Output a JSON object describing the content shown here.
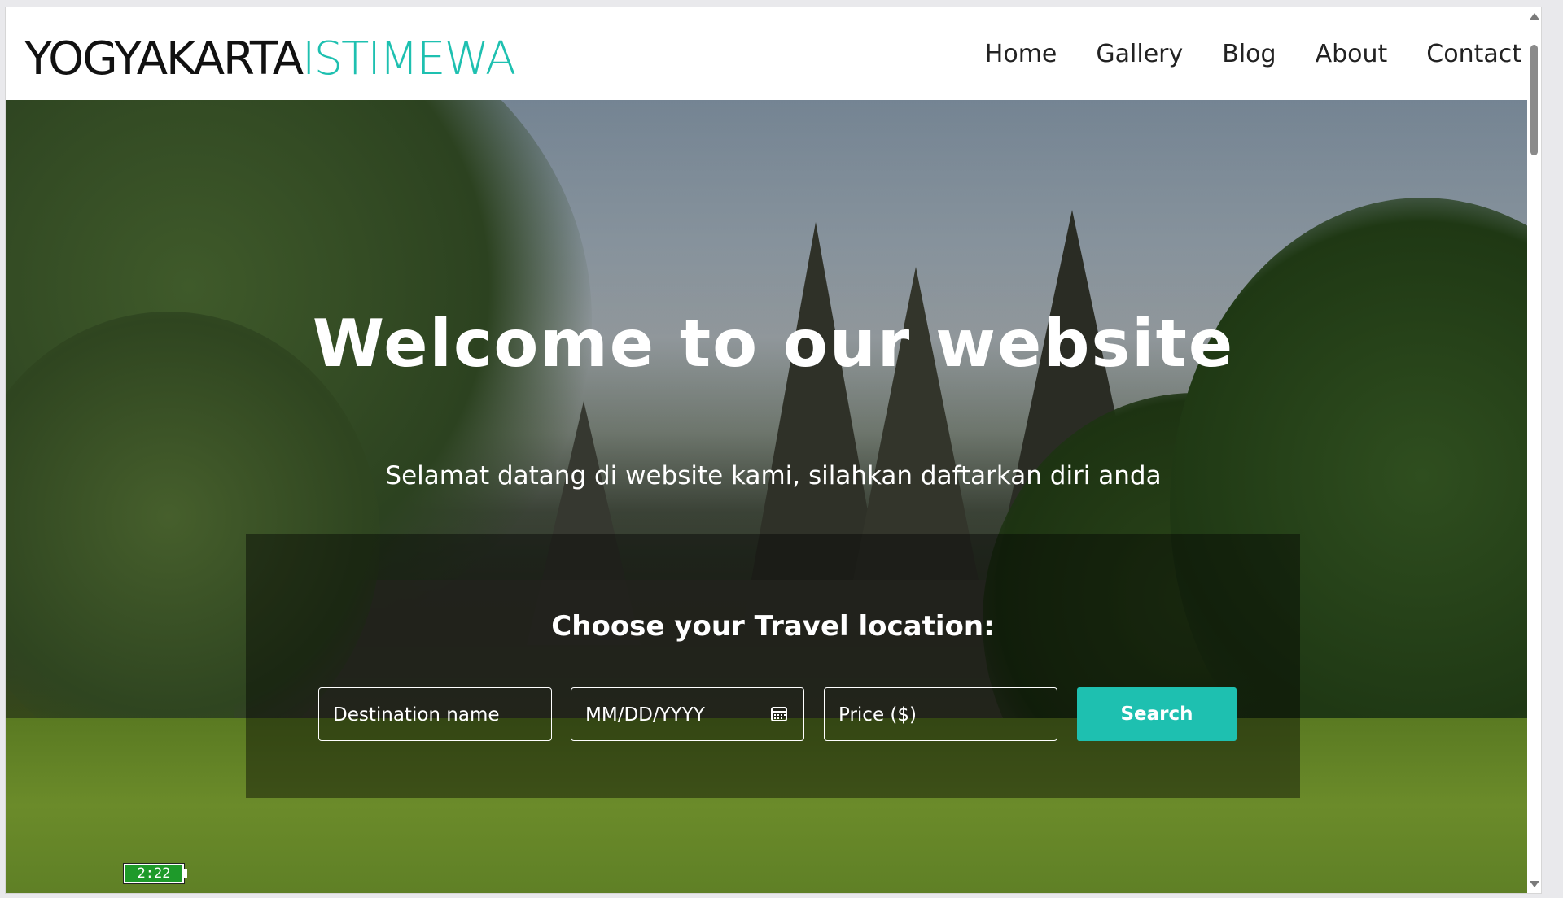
{
  "site": {
    "logo_main": "YOGYAKARTA",
    "logo_accent": "ISTIMEWA"
  },
  "nav": {
    "items": [
      {
        "label": "Home"
      },
      {
        "label": "Gallery"
      },
      {
        "label": "Blog"
      },
      {
        "label": "About"
      },
      {
        "label": "Contact"
      }
    ]
  },
  "hero": {
    "title": "Welcome to our website",
    "subtitle": "Selamat datang di website kami, silahkan daftarkan diri anda"
  },
  "search": {
    "heading": "Choose your Travel location:",
    "destination_placeholder": "Destination name",
    "date_placeholder": "MM/DD/YYYY",
    "price_placeholder": "Price ($)",
    "button_label": "Search",
    "calendar_icon": "calendar-icon"
  },
  "battery": {
    "time": "2:22"
  },
  "colors": {
    "accent": "#1ec0b0",
    "logo_dark": "#111111",
    "nav_text": "#222222"
  }
}
